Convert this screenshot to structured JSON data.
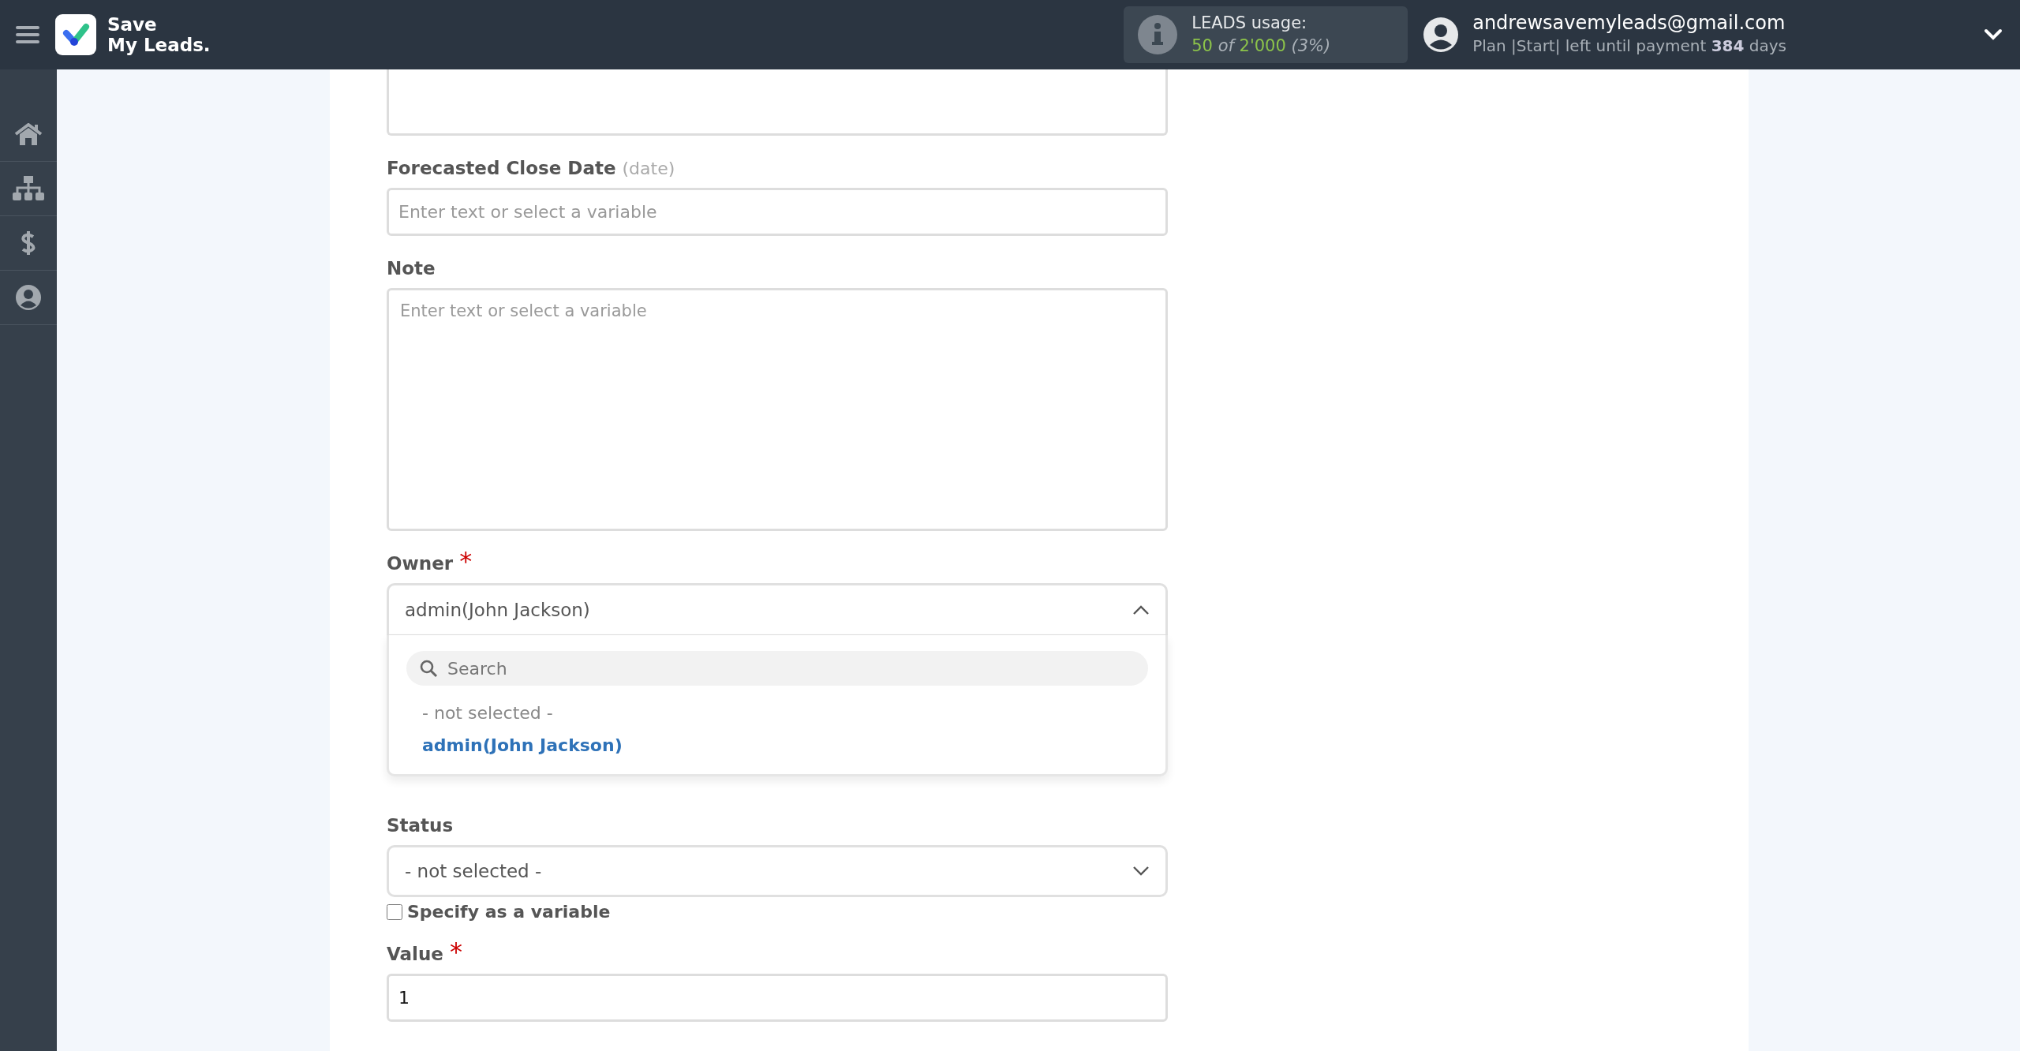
{
  "header": {
    "brand": [
      "Save",
      "My Leads."
    ],
    "usage": {
      "label": "LEADS usage:",
      "used": "50",
      "of": "of",
      "total": "2'000",
      "percent": "(3%)"
    },
    "account": {
      "email": "andrewsavemyleads@gmail.com",
      "plan": "Plan |Start| left until payment **384** days"
    }
  },
  "fields": [
    {
      "kind": "textarea_cut"
    },
    {
      "kind": "text",
      "label": "Forecasted Close Date",
      "hint": "(date)",
      "placeholder": "Enter text or select a variable"
    },
    {
      "kind": "textarea",
      "label": "Note",
      "placeholder": "Enter text or select a variable"
    },
    {
      "kind": "select",
      "label": "Owner",
      "required_mark": "*",
      "value": "admin(John Jackson)",
      "expanded": true,
      "search_placeholder": "Search",
      "options": [
        {
          "label": "- not selected -",
          "selected": false
        },
        {
          "label": "admin(John Jackson)",
          "selected": true
        }
      ]
    },
    {
      "kind": "select",
      "label": "Status",
      "value": "- not selected -",
      "expanded": false,
      "checkbox": {
        "label": "Specify as a variable",
        "checked": false
      }
    },
    {
      "kind": "text",
      "label": "Value",
      "required_mark": "*",
      "value": "1"
    }
  ]
}
